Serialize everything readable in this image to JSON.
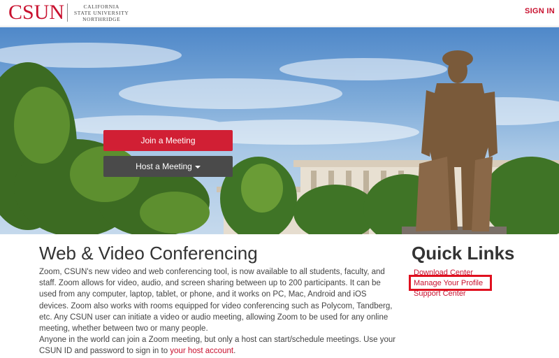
{
  "header": {
    "logo_mark": "CSUN",
    "logo_line1": "CALIFORNIA",
    "logo_line2": "STATE UNIVERSITY",
    "logo_line3": "NORTHRIDGE",
    "signin_label": "SIGN IN"
  },
  "hero": {
    "join_label": "Join a Meeting",
    "host_label": "Host a Meeting",
    "host_icon": "caret-down-icon"
  },
  "main": {
    "title": "Web & Video Conferencing",
    "para1": "Zoom, CSUN's new video and web conferencing tool, is now available to all students, faculty, and staff. Zoom allows for video, audio, and screen sharing between up to 200 participants. It can be used from any computer, laptop, tablet, or phone, and it works on PC, Mac, Android and iOS devices. Zoom also works with rooms equipped for video conferencing such as Polycom, Tandberg, etc. Any CSUN user can initiate a video or audio meeting, allowing Zoom to be used for any online meeting, whether between two or many people.",
    "para2_text": "Anyone in the world can join a Zoom meeting, but only a host can start/schedule meetings. Use your CSUN ID and password to sign in to ",
    "para2_link": "your host account",
    "para2_end": "."
  },
  "quick_links": {
    "title": "Quick Links",
    "items": [
      "Download Center",
      "Manage Your Profile",
      "Support Center"
    ]
  },
  "colors": {
    "brand": "#c8102e",
    "join_button": "#d11f34",
    "host_button": "#4a4a4a",
    "highlight": "#e0101f"
  }
}
